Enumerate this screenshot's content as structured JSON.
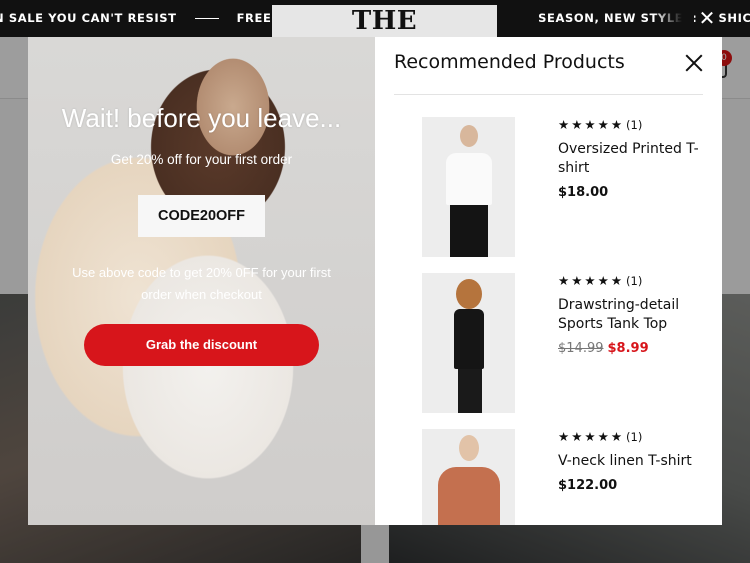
{
  "announcement": {
    "items": [
      "N SALE YOU CAN'T RESIST",
      "FREE SH",
      "SEASON, NEW STYLES: FASHIC"
    ],
    "close_icon": "close-icon"
  },
  "brand": {
    "logo_text": "THE"
  },
  "header": {
    "cart_count": "0"
  },
  "promo": {
    "title": "Wait! before you leave...",
    "subtitle": "Get 20% off for your first order",
    "code": "CODE20OFF",
    "note": "Use above code to get 20% 0FF for your first order when checkout",
    "button_label": "Grab the discount",
    "button_color": "#d7151b"
  },
  "recommended": {
    "title": "Recommended Products",
    "products": [
      {
        "rating_stars": "★★★★★",
        "review_count": "(1)",
        "name": "Oversized Printed T-shirt",
        "price": "$18.00",
        "old_price": "",
        "sale_price": ""
      },
      {
        "rating_stars": "★★★★★",
        "review_count": "(1)",
        "name": "Drawstring-detail Sports Tank Top",
        "price": "",
        "old_price": "$14.99",
        "sale_price": "$8.99"
      },
      {
        "rating_stars": "★★★★★",
        "review_count": "(1)",
        "name": "V-neck linen T-shirt",
        "price": "$122.00",
        "old_price": "",
        "sale_price": ""
      }
    ]
  },
  "colors": {
    "accent": "#d7151b",
    "topbar": "#111111"
  }
}
